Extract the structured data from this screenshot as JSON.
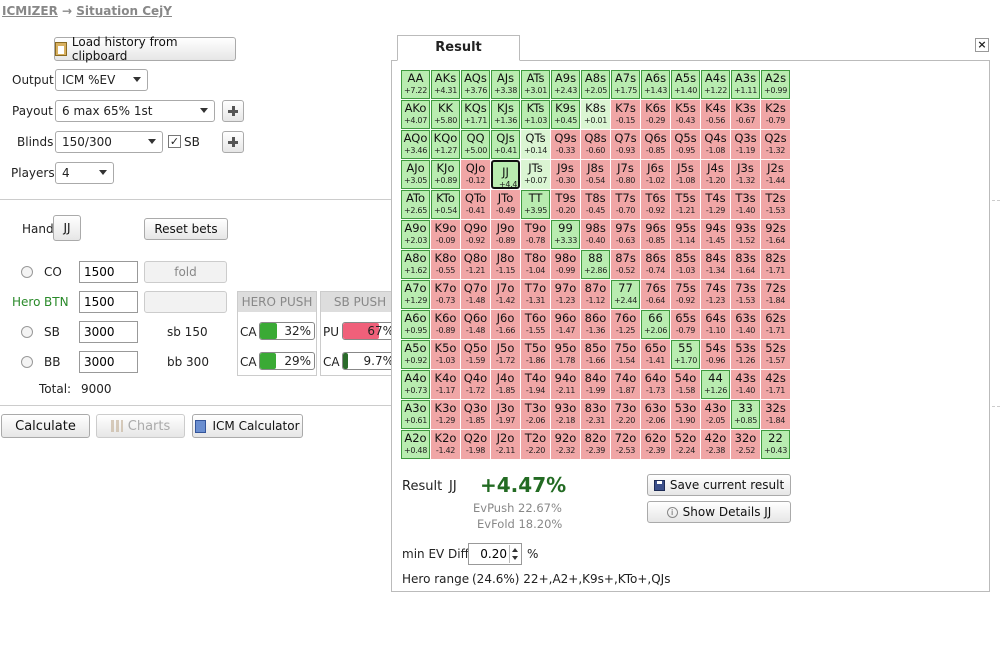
{
  "breadcrumb": {
    "root": "ICMIZER",
    "sep": "→",
    "current": "Situation CejY"
  },
  "form": {
    "load_history": "Load history from clipboard",
    "output_label": "Output",
    "output_value": "ICM %EV",
    "payout_label": "Payout",
    "payout_value": "6 max 65% 1st",
    "blinds_label": "Blinds",
    "blinds_value": "150/300",
    "sb_check_label": "SB",
    "players_label": "Players",
    "players_value": "4",
    "hand_label": "Hand",
    "hand_value": "JJ",
    "reset_bets": "Reset bets",
    "positions": [
      {
        "name": "CO",
        "stack": "1500",
        "action": "fold",
        "hero": false
      },
      {
        "name": "BTN",
        "stack": "1500",
        "action": "",
        "hero": true,
        "hero_label": "Hero"
      },
      {
        "name": "SB",
        "stack": "3000",
        "action": "sb 150",
        "hero": false
      },
      {
        "name": "BB",
        "stack": "3000",
        "action": "bb 300",
        "hero": false
      }
    ],
    "total_label": "Total:",
    "total_value": "9000"
  },
  "hero_push": {
    "title": "HERO PUSH",
    "rows": [
      {
        "label": "CA",
        "value": "32%",
        "fraction": 0.32,
        "color": "#3aaa35"
      },
      {
        "label": "CA",
        "value": "29%",
        "fraction": 0.29,
        "color": "#3aaa35"
      }
    ]
  },
  "sb_push": {
    "title": "SB PUSH",
    "rows": [
      {
        "label": "PU",
        "value": "67%",
        "fraction": 0.67,
        "color": "#f0607a"
      },
      {
        "label": "CA",
        "value": "9.7%",
        "fraction": 0.097,
        "color": "#2a6a2a"
      }
    ]
  },
  "toolbar": {
    "calculate": "Calculate",
    "charts": "Charts",
    "icm_calculator": "ICM Calculator"
  },
  "result": {
    "tab": "Result",
    "close": "×",
    "result_label": "Result",
    "result_hand": "JJ",
    "result_value": "+4.47%",
    "evpush": "EvPush 22.67%",
    "evfold": "EvFold 18.20%",
    "save_button": "Save current result",
    "details_button": "Show Details JJ",
    "min_ev_label": "min EV Diff",
    "min_ev_value": "0.20",
    "min_ev_unit": "%",
    "hero_range_label": "Hero range",
    "hero_range_value": "(24.6%) 22+,A2+,K9s+,KTo+,QJs"
  },
  "matrix": [
    [
      [
        "AA",
        "+7.22",
        "in"
      ],
      [
        "AKs",
        "+4.31",
        "in"
      ],
      [
        "AQs",
        "+3.76",
        "in"
      ],
      [
        "AJs",
        "+3.38",
        "in"
      ],
      [
        "ATs",
        "+3.01",
        "in"
      ],
      [
        "A9s",
        "+2.43",
        "in"
      ],
      [
        "A8s",
        "+2.05",
        "in"
      ],
      [
        "A7s",
        "+1.75",
        "in"
      ],
      [
        "A6s",
        "+1.43",
        "in"
      ],
      [
        "A5s",
        "+1.40",
        "in"
      ],
      [
        "A4s",
        "+1.22",
        "in"
      ],
      [
        "A3s",
        "+1.11",
        "in"
      ],
      [
        "A2s",
        "+0.99",
        "in"
      ]
    ],
    [
      [
        "AKo",
        "+4.07",
        "in"
      ],
      [
        "KK",
        "+5.80",
        "in"
      ],
      [
        "KQs",
        "+1.71",
        "in"
      ],
      [
        "KJs",
        "+1.36",
        "in"
      ],
      [
        "KTs",
        "+1.03",
        "in"
      ],
      [
        "K9s",
        "+0.45",
        "in"
      ],
      [
        "K8s",
        "+0.01",
        "pale"
      ],
      [
        "K7s",
        "-0.15",
        "out"
      ],
      [
        "K6s",
        "-0.29",
        "out"
      ],
      [
        "K5s",
        "-0.43",
        "out"
      ],
      [
        "K4s",
        "-0.56",
        "out"
      ],
      [
        "K3s",
        "-0.67",
        "out"
      ],
      [
        "K2s",
        "-0.79",
        "out"
      ]
    ],
    [
      [
        "AQo",
        "+3.46",
        "in"
      ],
      [
        "KQo",
        "+1.27",
        "in"
      ],
      [
        "QQ",
        "+5.00",
        "in"
      ],
      [
        "QJs",
        "+0.41",
        "in"
      ],
      [
        "QTs",
        "+0.14",
        "pale"
      ],
      [
        "Q9s",
        "-0.33",
        "out"
      ],
      [
        "Q8s",
        "-0.60",
        "out"
      ],
      [
        "Q7s",
        "-0.93",
        "out"
      ],
      [
        "Q6s",
        "-0.85",
        "out"
      ],
      [
        "Q5s",
        "-0.95",
        "out"
      ],
      [
        "Q4s",
        "-1.08",
        "out"
      ],
      [
        "Q3s",
        "-1.19",
        "out"
      ],
      [
        "Q2s",
        "-1.32",
        "out"
      ]
    ],
    [
      [
        "AJo",
        "+3.05",
        "in"
      ],
      [
        "KJo",
        "+0.89",
        "in"
      ],
      [
        "QJo",
        "-0.12",
        "out"
      ],
      [
        "JJ",
        "+4.47",
        "in sel"
      ],
      [
        "JTs",
        "+0.07",
        "pale"
      ],
      [
        "J9s",
        "-0.30",
        "out"
      ],
      [
        "J8s",
        "-0.54",
        "out"
      ],
      [
        "J7s",
        "-0.80",
        "out"
      ],
      [
        "J6s",
        "-1.02",
        "out"
      ],
      [
        "J5s",
        "-1.08",
        "out"
      ],
      [
        "J4s",
        "-1.20",
        "out"
      ],
      [
        "J3s",
        "-1.32",
        "out"
      ],
      [
        "J2s",
        "-1.44",
        "out"
      ]
    ],
    [
      [
        "ATo",
        "+2.65",
        "in"
      ],
      [
        "KTo",
        "+0.54",
        "in"
      ],
      [
        "QTo",
        "-0.41",
        "out"
      ],
      [
        "JTo",
        "-0.49",
        "out"
      ],
      [
        "TT",
        "+3.95",
        "in"
      ],
      [
        "T9s",
        "-0.20",
        "out"
      ],
      [
        "T8s",
        "-0.45",
        "out"
      ],
      [
        "T7s",
        "-0.70",
        "out"
      ],
      [
        "T6s",
        "-0.92",
        "out"
      ],
      [
        "T5s",
        "-1.21",
        "out"
      ],
      [
        "T4s",
        "-1.29",
        "out"
      ],
      [
        "T3s",
        "-1.40",
        "out"
      ],
      [
        "T2s",
        "-1.53",
        "out"
      ]
    ],
    [
      [
        "A9o",
        "+2.03",
        "in"
      ],
      [
        "K9o",
        "-0.09",
        "out"
      ],
      [
        "Q9o",
        "-0.92",
        "out"
      ],
      [
        "J9o",
        "-0.89",
        "out"
      ],
      [
        "T9o",
        "-0.78",
        "out"
      ],
      [
        "99",
        "+3.33",
        "in"
      ],
      [
        "98s",
        "-0.40",
        "out"
      ],
      [
        "97s",
        "-0.63",
        "out"
      ],
      [
        "96s",
        "-0.85",
        "out"
      ],
      [
        "95s",
        "-1.14",
        "out"
      ],
      [
        "94s",
        "-1.45",
        "out"
      ],
      [
        "93s",
        "-1.52",
        "out"
      ],
      [
        "92s",
        "-1.64",
        "out"
      ]
    ],
    [
      [
        "A8o",
        "+1.62",
        "in"
      ],
      [
        "K8o",
        "-0.55",
        "out"
      ],
      [
        "Q8o",
        "-1.21",
        "out"
      ],
      [
        "J8o",
        "-1.15",
        "out"
      ],
      [
        "T8o",
        "-1.04",
        "out"
      ],
      [
        "98o",
        "-0.99",
        "out"
      ],
      [
        "88",
        "+2.86",
        "in"
      ],
      [
        "87s",
        "-0.52",
        "out"
      ],
      [
        "86s",
        "-0.74",
        "out"
      ],
      [
        "85s",
        "-1.03",
        "out"
      ],
      [
        "84s",
        "-1.34",
        "out"
      ],
      [
        "83s",
        "-1.64",
        "out"
      ],
      [
        "82s",
        "-1.71",
        "out"
      ]
    ],
    [
      [
        "A7o",
        "+1.29",
        "in"
      ],
      [
        "K7o",
        "-0.73",
        "out"
      ],
      [
        "Q7o",
        "-1.48",
        "out"
      ],
      [
        "J7o",
        "-1.42",
        "out"
      ],
      [
        "T7o",
        "-1.31",
        "out"
      ],
      [
        "97o",
        "-1.23",
        "out"
      ],
      [
        "87o",
        "-1.12",
        "out"
      ],
      [
        "77",
        "+2.44",
        "in"
      ],
      [
        "76s",
        "-0.64",
        "out"
      ],
      [
        "75s",
        "-0.92",
        "out"
      ],
      [
        "74s",
        "-1.23",
        "out"
      ],
      [
        "73s",
        "-1.53",
        "out"
      ],
      [
        "72s",
        "-1.84",
        "out"
      ]
    ],
    [
      [
        "A6o",
        "+0.95",
        "in"
      ],
      [
        "K6o",
        "-0.89",
        "out"
      ],
      [
        "Q6o",
        "-1.48",
        "out"
      ],
      [
        "J6o",
        "-1.66",
        "out"
      ],
      [
        "T6o",
        "-1.55",
        "out"
      ],
      [
        "96o",
        "-1.47",
        "out"
      ],
      [
        "86o",
        "-1.36",
        "out"
      ],
      [
        "76o",
        "-1.25",
        "out"
      ],
      [
        "66",
        "+2.06",
        "in"
      ],
      [
        "65s",
        "-0.79",
        "out"
      ],
      [
        "64s",
        "-1.10",
        "out"
      ],
      [
        "63s",
        "-1.40",
        "out"
      ],
      [
        "62s",
        "-1.71",
        "out"
      ]
    ],
    [
      [
        "A5o",
        "+0.92",
        "in"
      ],
      [
        "K5o",
        "-1.03",
        "out"
      ],
      [
        "Q5o",
        "-1.59",
        "out"
      ],
      [
        "J5o",
        "-1.72",
        "out"
      ],
      [
        "T5o",
        "-1.86",
        "out"
      ],
      [
        "95o",
        "-1.78",
        "out"
      ],
      [
        "85o",
        "-1.66",
        "out"
      ],
      [
        "75o",
        "-1.54",
        "out"
      ],
      [
        "65o",
        "-1.41",
        "out"
      ],
      [
        "55",
        "+1.70",
        "in"
      ],
      [
        "54s",
        "-0.96",
        "out"
      ],
      [
        "53s",
        "-1.26",
        "out"
      ],
      [
        "52s",
        "-1.57",
        "out"
      ]
    ],
    [
      [
        "A4o",
        "+0.73",
        "in"
      ],
      [
        "K4o",
        "-1.17",
        "out"
      ],
      [
        "Q4o",
        "-1.72",
        "out"
      ],
      [
        "J4o",
        "-1.85",
        "out"
      ],
      [
        "T4o",
        "-1.94",
        "out"
      ],
      [
        "94o",
        "-2.11",
        "out"
      ],
      [
        "84o",
        "-1.99",
        "out"
      ],
      [
        "74o",
        "-1.87",
        "out"
      ],
      [
        "64o",
        "-1.73",
        "out"
      ],
      [
        "54o",
        "-1.58",
        "out"
      ],
      [
        "44",
        "+1.26",
        "in"
      ],
      [
        "43s",
        "-1.40",
        "out"
      ],
      [
        "42s",
        "-1.71",
        "out"
      ]
    ],
    [
      [
        "A3o",
        "+0.61",
        "in"
      ],
      [
        "K3o",
        "-1.29",
        "out"
      ],
      [
        "Q3o",
        "-1.85",
        "out"
      ],
      [
        "J3o",
        "-1.97",
        "out"
      ],
      [
        "T3o",
        "-2.06",
        "out"
      ],
      [
        "93o",
        "-2.18",
        "out"
      ],
      [
        "83o",
        "-2.31",
        "out"
      ],
      [
        "73o",
        "-2.20",
        "out"
      ],
      [
        "63o",
        "-2.06",
        "out"
      ],
      [
        "53o",
        "-1.90",
        "out"
      ],
      [
        "43o",
        "-2.05",
        "out"
      ],
      [
        "33",
        "+0.85",
        "in"
      ],
      [
        "32s",
        "-1.84",
        "out"
      ]
    ],
    [
      [
        "A2o",
        "+0.48",
        "in"
      ],
      [
        "K2o",
        "-1.42",
        "out"
      ],
      [
        "Q2o",
        "-1.98",
        "out"
      ],
      [
        "J2o",
        "-2.11",
        "out"
      ],
      [
        "T2o",
        "-2.20",
        "out"
      ],
      [
        "92o",
        "-2.32",
        "out"
      ],
      [
        "82o",
        "-2.39",
        "out"
      ],
      [
        "72o",
        "-2.53",
        "out"
      ],
      [
        "62o",
        "-2.39",
        "out"
      ],
      [
        "52o",
        "-2.24",
        "out"
      ],
      [
        "42o",
        "-2.38",
        "out"
      ],
      [
        "32o",
        "-2.52",
        "out"
      ],
      [
        "22",
        "+0.43",
        "in"
      ]
    ]
  ]
}
